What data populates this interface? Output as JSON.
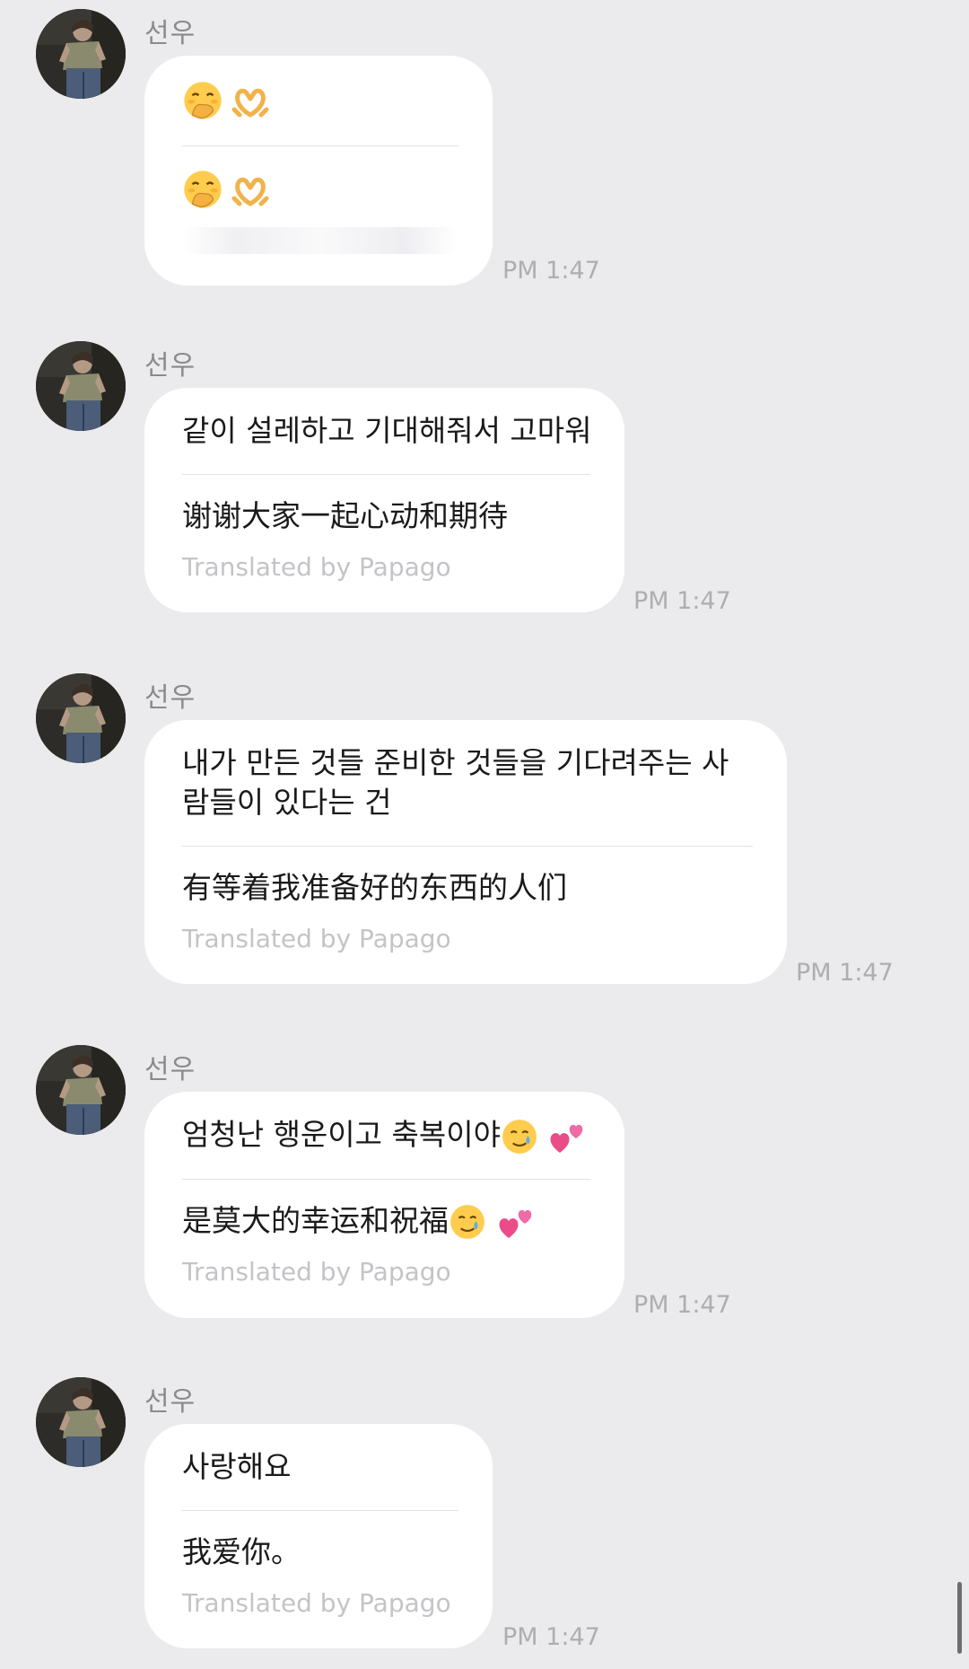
{
  "colors": {
    "background": "#ebebed",
    "bubble": "#ffffff",
    "timestamp": "#aeaeb2",
    "translation_credit": "#c4c4c8"
  },
  "messages": [
    {
      "sender": "선우",
      "original_emojis": [
        "face-with-hand-over-mouth",
        "heart-hands"
      ],
      "translated_emojis": [
        "face-with-hand-over-mouth",
        "heart-hands"
      ],
      "time": "PM 1:47"
    },
    {
      "sender": "선우",
      "original": "같이 설레하고 기대해줘서 고마워",
      "translated": "谢谢大家一起心动和期待",
      "credit": "Translated by Papago",
      "time": "PM 1:47"
    },
    {
      "sender": "선우",
      "original": "내가 만든 것들 준비한 것들을 기다려주는 사람들이 있다는 건",
      "translated": "有等着我准备好的东西的人们",
      "credit": "Translated by Papago",
      "time": "PM 1:47"
    },
    {
      "sender": "선우",
      "original": "엄청난 행운이고 축복이야",
      "translated": "是莫大的幸运和祝福",
      "emojis": [
        "smiling-face-with-tear",
        "two-hearts"
      ],
      "credit": "Translated by Papago",
      "time": "PM 1:47"
    },
    {
      "sender": "선우",
      "original": "사랑해요",
      "translated": "我爱你。",
      "credit": "Translated by Papago",
      "time": "PM 1:47"
    }
  ]
}
